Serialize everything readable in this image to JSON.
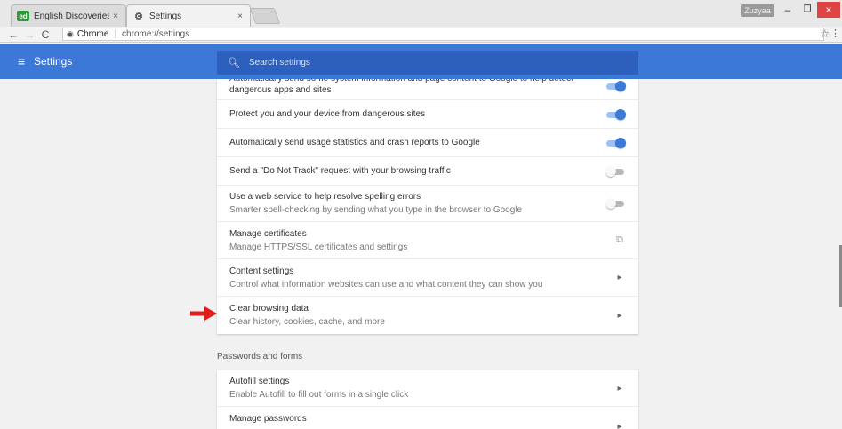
{
  "tabs": [
    {
      "title": "English Discoveries",
      "icon_text": "ed",
      "icon_color": "#2f9a3a",
      "close": "×"
    },
    {
      "title": "Settings",
      "icon_text": "⚙",
      "close": "×"
    }
  ],
  "window": {
    "user": "Zuzyaa",
    "minimize": "–",
    "maximize": "❐",
    "close": "×"
  },
  "address": {
    "site": "Chrome",
    "url": "chrome://settings"
  },
  "header": {
    "title": "Settings",
    "search_placeholder": "Search settings"
  },
  "privacy_rows": [
    {
      "text": "Automatically send some system information and page content to Google to help detect dangerous apps and sites",
      "control": "toggle",
      "on": true
    },
    {
      "text": "Protect you and your device from dangerous sites",
      "control": "toggle",
      "on": true
    },
    {
      "text": "Automatically send usage statistics and crash reports to Google",
      "control": "toggle",
      "on": true
    },
    {
      "text": "Send a \"Do Not Track\" request with your browsing traffic",
      "control": "toggle",
      "on": false
    },
    {
      "text": "Use a web service to help resolve spelling errors",
      "sub": "Smarter spell-checking by sending what you type in the browser to Google",
      "control": "toggle",
      "on": false
    },
    {
      "text": "Manage certificates",
      "sub": "Manage HTTPS/SSL certificates and settings",
      "control": "external"
    },
    {
      "text": "Content settings",
      "sub": "Control what information websites can use and what content they can show you",
      "control": "chevron"
    },
    {
      "text": "Clear browsing data",
      "sub": "Clear history, cookies, cache, and more",
      "control": "chevron"
    }
  ],
  "passwords_section": {
    "label": "Passwords and forms",
    "rows": [
      {
        "text": "Autofill settings",
        "sub": "Enable Autofill to fill out forms in a single click",
        "control": "chevron"
      },
      {
        "text": "Manage passwords",
        "control": "chevron"
      }
    ]
  },
  "colors": {
    "accent": "#3c78d8",
    "annotation_arrow": "#e21b1b"
  }
}
